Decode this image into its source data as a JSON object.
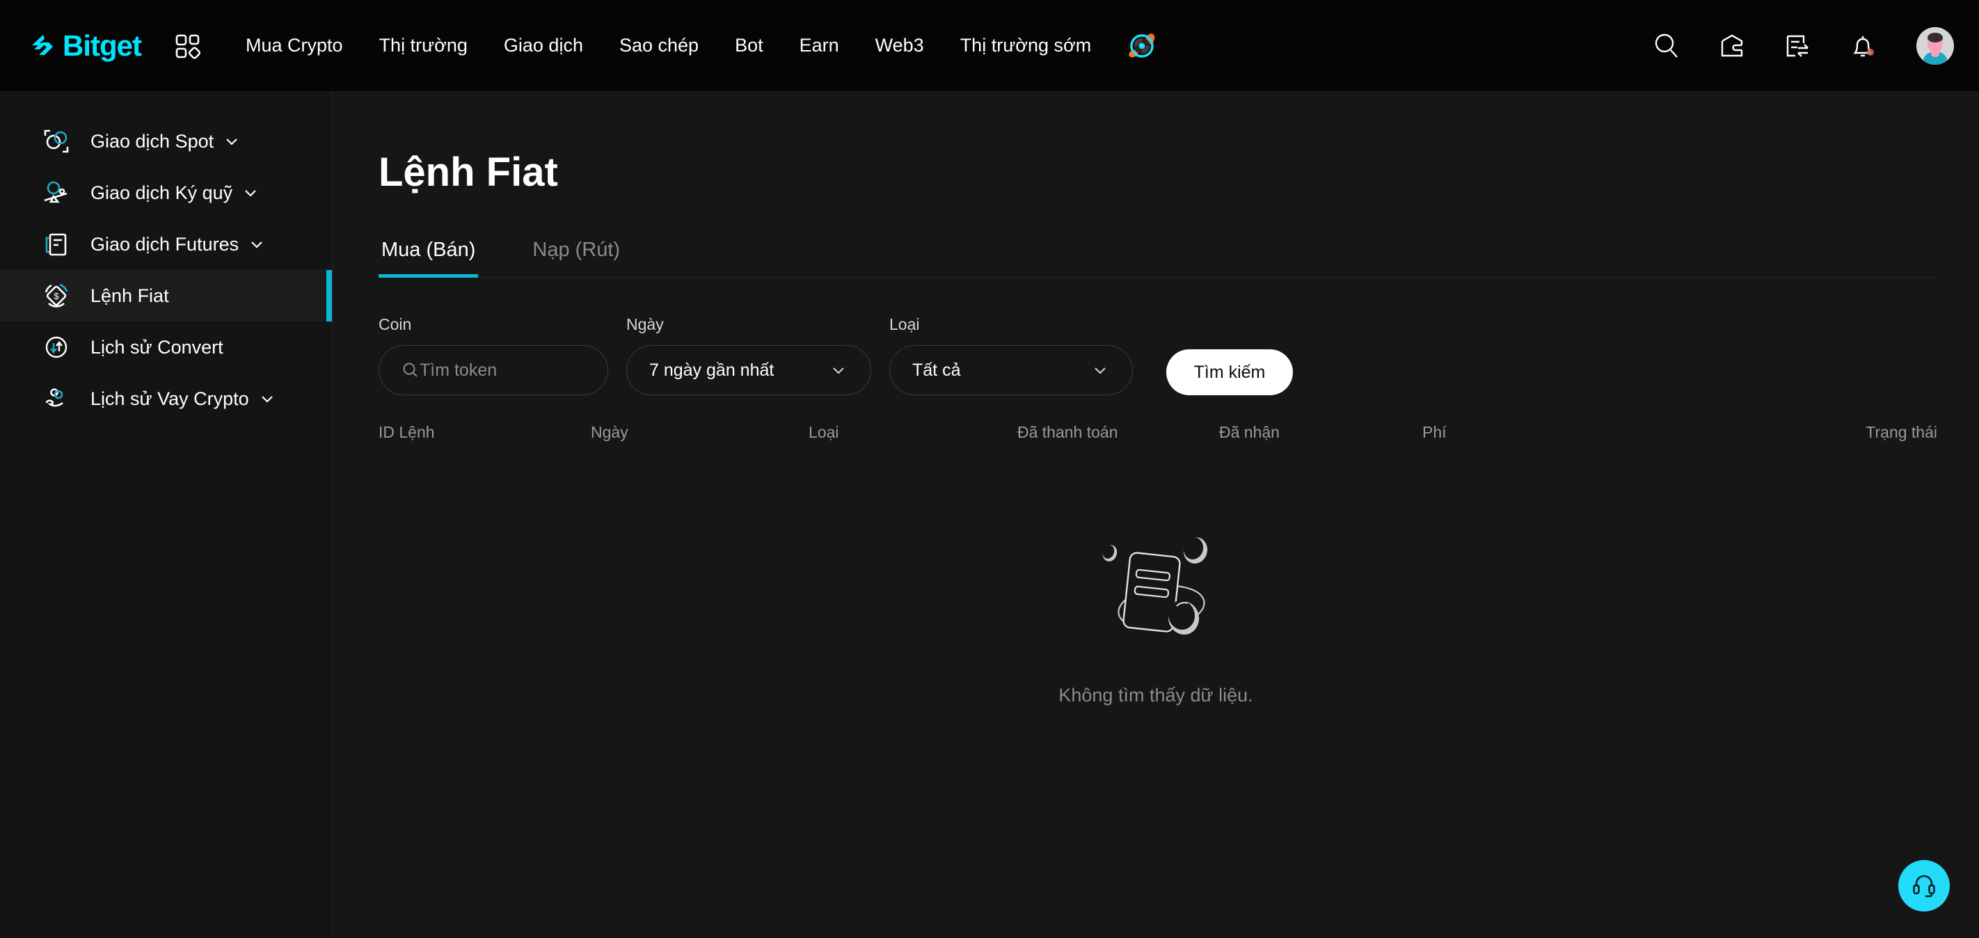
{
  "brand": {
    "name": "Bitget",
    "accent": "#00e5ff"
  },
  "topnav": {
    "apps_icon": "grid-apps-icon",
    "links": [
      {
        "label": "Mua Crypto",
        "name": "nav-mua-crypto"
      },
      {
        "label": "Thị trường",
        "name": "nav-thi-truong"
      },
      {
        "label": "Giao dịch",
        "name": "nav-giao-dich"
      },
      {
        "label": "Sao chép",
        "name": "nav-sao-chep"
      },
      {
        "label": "Bot",
        "name": "nav-bot"
      },
      {
        "label": "Earn",
        "name": "nav-earn"
      },
      {
        "label": "Web3",
        "name": "nav-web3"
      },
      {
        "label": "Thị trường sớm",
        "name": "nav-thi-truong-som"
      }
    ],
    "promo_icon": "target-promo-icon",
    "actions": [
      {
        "name": "search-icon"
      },
      {
        "name": "wallet-icon"
      },
      {
        "name": "orders-transfer-icon"
      },
      {
        "name": "bell-notification-icon"
      }
    ],
    "avatar": "user-avatar"
  },
  "sidebar": {
    "items": [
      {
        "label": "Giao dịch Spot",
        "icon": "spot-trade-icon",
        "chevron": true,
        "active": false
      },
      {
        "label": "Giao dịch Ký quỹ",
        "icon": "margin-trade-icon",
        "chevron": true,
        "active": false
      },
      {
        "label": "Giao dịch Futures",
        "icon": "futures-trade-icon",
        "chevron": true,
        "active": false
      },
      {
        "label": "Lệnh Fiat",
        "icon": "fiat-orders-icon",
        "chevron": false,
        "active": true
      },
      {
        "label": "Lịch sử Convert",
        "icon": "convert-history-icon",
        "chevron": false,
        "active": false
      },
      {
        "label": "Lịch sử Vay Crypto",
        "icon": "loan-history-icon",
        "chevron": true,
        "active": false
      }
    ]
  },
  "page": {
    "title": "Lệnh Fiat",
    "tabs": [
      {
        "label": "Mua (Bán)",
        "active": true
      },
      {
        "label": "Nạp (Rút)",
        "active": false
      }
    ],
    "filters": {
      "coin": {
        "label": "Coin",
        "placeholder": "Tìm token",
        "value": ""
      },
      "date": {
        "label": "Ngày",
        "value": "7 ngày gần nhất"
      },
      "type": {
        "label": "Loại",
        "value": "Tất cả"
      },
      "search_button": "Tìm kiếm"
    },
    "table": {
      "columns": [
        "ID Lệnh",
        "Ngày",
        "Loại",
        "Đã thanh toán",
        "Đã nhận",
        "Phí",
        "Trạng thái"
      ]
    },
    "empty_state": {
      "text": "Không tìm thấy dữ liệu.",
      "illustration": "no-data-document-illustration"
    }
  },
  "support": {
    "icon": "headset-support-icon",
    "color": "#22dcfa"
  }
}
